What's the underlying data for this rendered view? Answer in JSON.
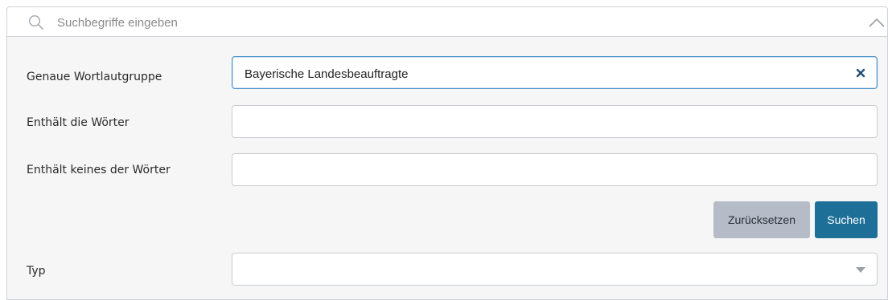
{
  "search": {
    "placeholder": "Suchbegriffe eingeben",
    "value": ""
  },
  "form": {
    "exact_phrase": {
      "label": "Genaue Wortlautgruppe",
      "value": "Bayerische Landesbeauftragte"
    },
    "contains_words": {
      "label": "Enthält die Wörter",
      "value": ""
    },
    "excludes_words": {
      "label": "Enthält keines der Wörter",
      "value": ""
    },
    "type": {
      "label": "Typ",
      "value": ""
    }
  },
  "buttons": {
    "reset_label": "Zurücksetzen",
    "search_label": "Suchen"
  },
  "colors": {
    "panel_background": "#f6f6f6",
    "primary_button": "#1e6f98",
    "secondary_button": "#b6bcc7",
    "active_border": "#4a90c8"
  },
  "icons": {
    "search": "search-icon",
    "collapse": "chevron-up-icon",
    "clear": "close-icon",
    "dropdown": "caret-down-icon"
  }
}
